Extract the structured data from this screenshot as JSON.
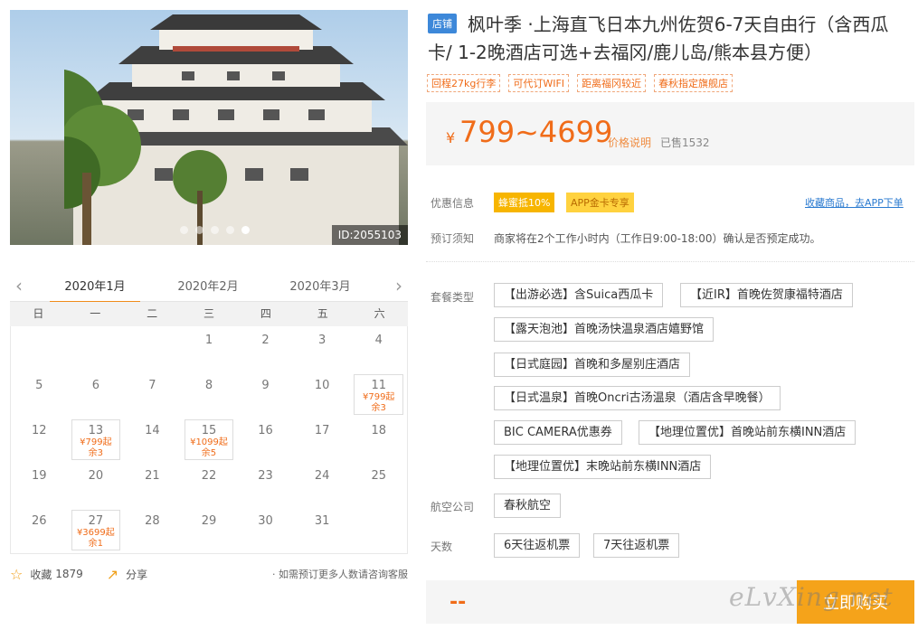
{
  "hero": {
    "id_label": "ID:2055103",
    "dot_count": 5,
    "active_dot": 5
  },
  "calendar": {
    "months": [
      "2020年1月",
      "2020年2月",
      "2020年3月"
    ],
    "active_month": "2020年1月",
    "weekdays": [
      "日",
      "一",
      "二",
      "三",
      "四",
      "五",
      "六"
    ],
    "weeks": [
      [
        {
          "d": ""
        },
        {
          "d": ""
        },
        {
          "d": ""
        },
        {
          "d": "1"
        },
        {
          "d": "2"
        },
        {
          "d": "3"
        },
        {
          "d": "4"
        }
      ],
      [
        {
          "d": "5"
        },
        {
          "d": "6"
        },
        {
          "d": "7"
        },
        {
          "d": "8"
        },
        {
          "d": "9"
        },
        {
          "d": "10"
        },
        {
          "d": "11",
          "price": "¥799起",
          "stock": "余3"
        }
      ],
      [
        {
          "d": "12"
        },
        {
          "d": "13",
          "price": "¥799起",
          "stock": "余3"
        },
        {
          "d": "14"
        },
        {
          "d": "15",
          "price": "¥1099起",
          "stock": "余5"
        },
        {
          "d": "16"
        },
        {
          "d": "17"
        },
        {
          "d": "18"
        }
      ],
      [
        {
          "d": "19"
        },
        {
          "d": "20"
        },
        {
          "d": "21"
        },
        {
          "d": "22"
        },
        {
          "d": "23"
        },
        {
          "d": "24"
        },
        {
          "d": "25"
        }
      ],
      [
        {
          "d": "26"
        },
        {
          "d": "27",
          "price": "¥3699起",
          "stock": "余1"
        },
        {
          "d": "28"
        },
        {
          "d": "29"
        },
        {
          "d": "30"
        },
        {
          "d": "31"
        },
        {
          "d": ""
        }
      ]
    ]
  },
  "share": {
    "fav_label": "收藏",
    "fav_count": "1879",
    "share_label": "分享",
    "note": "· 如需预订更多人数请咨询客服"
  },
  "product": {
    "shop_tag": "店铺",
    "title": "枫叶季 ·上海直飞日本九州佐贺6-7天自由行（含西瓜卡/ 1-2晚酒店可选+去福冈/鹿儿岛/熊本县方便）",
    "tags": [
      "回程27kg行李",
      "可代订WIFI",
      "距离福冈较近",
      "春秋指定旗舰店"
    ]
  },
  "price": {
    "currency": "¥",
    "range": "799~4699",
    "explain": "价格说明",
    "sold": "已售1532"
  },
  "promo": {
    "label": "优惠信息",
    "badge1": "蜂蜜抵10%",
    "badge2": "APP金卡专享",
    "app_link": "收藏商品，去APP下单"
  },
  "booking": {
    "label": "预订须知",
    "text": "商家将在2个工作小时内（工作日9:00-18:00）确认是否预定成功。"
  },
  "packages": {
    "label": "套餐类型",
    "options": [
      "【出游必选】含Suica西瓜卡",
      "【近IR】首晚佐贺康福特酒店",
      "【露天泡池】首晚汤快温泉酒店嬉野馆",
      "【日式庭园】首晚和多屋别庄酒店",
      "【日式温泉】首晚Oncri古汤温泉（酒店含早晚餐）",
      "BIC CAMERA优惠券",
      "【地理位置优】首晚站前东横INN酒店",
      "【地理位置优】末晚站前东横INN酒店"
    ]
  },
  "airline": {
    "label": "航空公司",
    "value": "春秋航空"
  },
  "days": {
    "label": "天数",
    "options": [
      "6天往返机票",
      "7天往返机票"
    ]
  },
  "buy": {
    "dash": "--",
    "button": "立即购买"
  },
  "watermark": "eLvXing.net",
  "colors": {
    "accent": "#f06c19",
    "buy_button": "#f5a31a",
    "shop_tag": "#3d88d9",
    "link": "#2b7bd0"
  }
}
